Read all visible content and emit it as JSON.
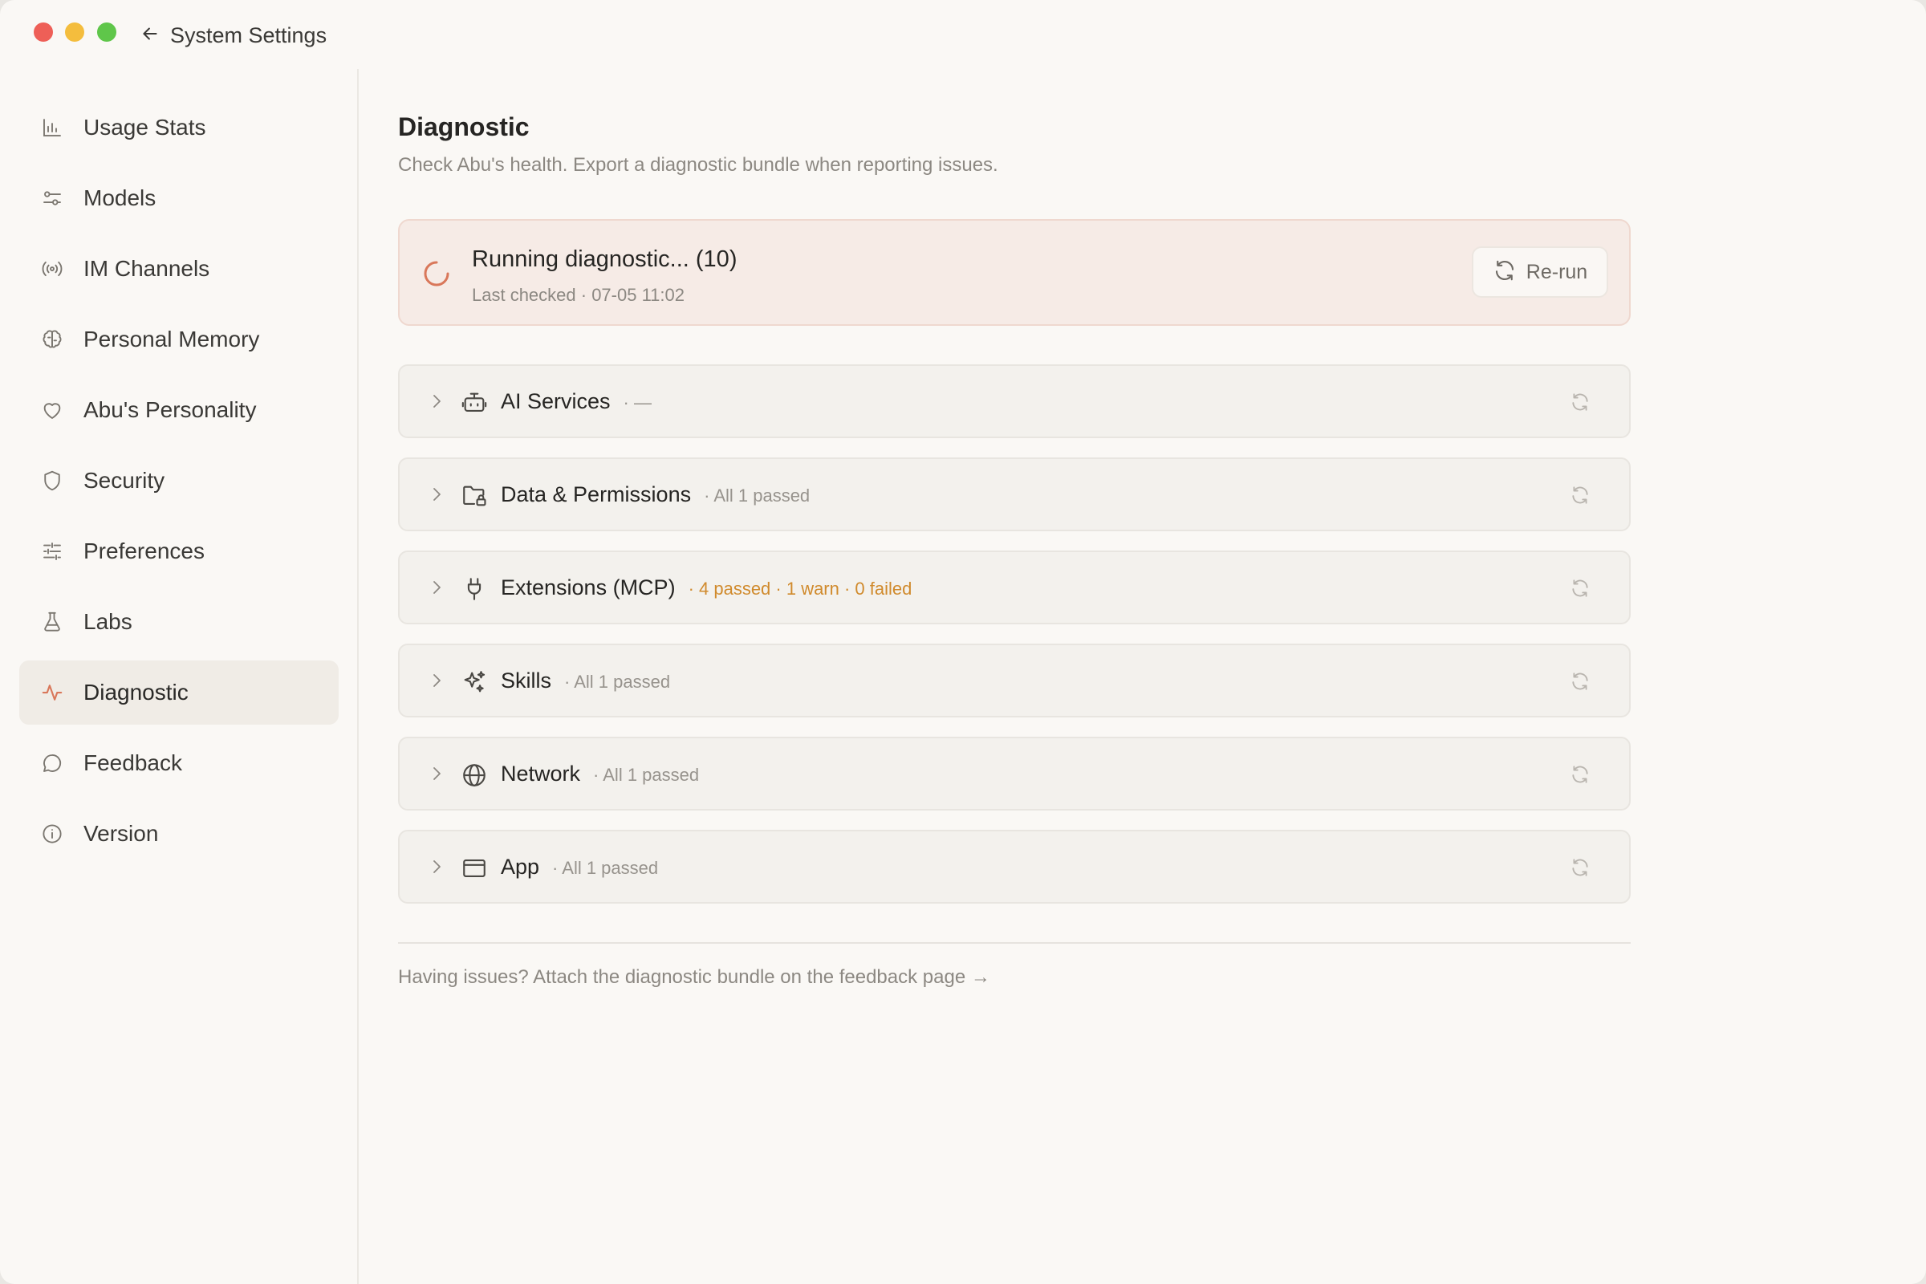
{
  "window": {
    "back_label": "System Settings"
  },
  "sidebar": {
    "items": [
      {
        "label": "Usage Stats",
        "icon": "bar-chart-icon"
      },
      {
        "label": "Models",
        "icon": "sliders-icon"
      },
      {
        "label": "IM Channels",
        "icon": "broadcast-icon"
      },
      {
        "label": "Personal Memory",
        "icon": "brain-icon"
      },
      {
        "label": "Abu's Personality",
        "icon": "heart-icon"
      },
      {
        "label": "Security",
        "icon": "shield-icon"
      },
      {
        "label": "Preferences",
        "icon": "adjustments-icon"
      },
      {
        "label": "Labs",
        "icon": "flask-icon"
      },
      {
        "label": "Diagnostic",
        "icon": "activity-icon",
        "active": true
      },
      {
        "label": "Feedback",
        "icon": "chat-bubble-icon"
      },
      {
        "label": "Version",
        "icon": "info-icon"
      }
    ]
  },
  "main": {
    "title": "Diagnostic",
    "subtitle": "Check Abu's health. Export a diagnostic bundle when reporting issues.",
    "status": {
      "title": "Running diagnostic...  (10)",
      "last_checked": "Last checked · 07-05 11:02",
      "rerun_label": "Re-run"
    },
    "groups": [
      {
        "name": "AI Services",
        "status": "· —",
        "icon": "robot-icon",
        "warn": false
      },
      {
        "name": "Data & Permissions",
        "status": "· All 1 passed",
        "icon": "folder-lock-icon",
        "warn": false
      },
      {
        "name": "Extensions (MCP)",
        "status": "· 4 passed · 1 warn · 0 failed",
        "icon": "plug-icon",
        "warn": true
      },
      {
        "name": "Skills",
        "status": "· All 1 passed",
        "icon": "sparkles-icon",
        "warn": false
      },
      {
        "name": "Network",
        "status": "· All 1 passed",
        "icon": "globe-icon",
        "warn": false
      },
      {
        "name": "App",
        "status": "· All 1 passed",
        "icon": "app-window-icon",
        "warn": false
      }
    ],
    "footer_link": "Having issues? Attach the diagnostic bundle on the feedback page →"
  },
  "colors": {
    "accent": "#d9775a",
    "warn": "#d08a2c",
    "active_bg": "#f0ece6",
    "status_bg": "#f6ebe6"
  }
}
